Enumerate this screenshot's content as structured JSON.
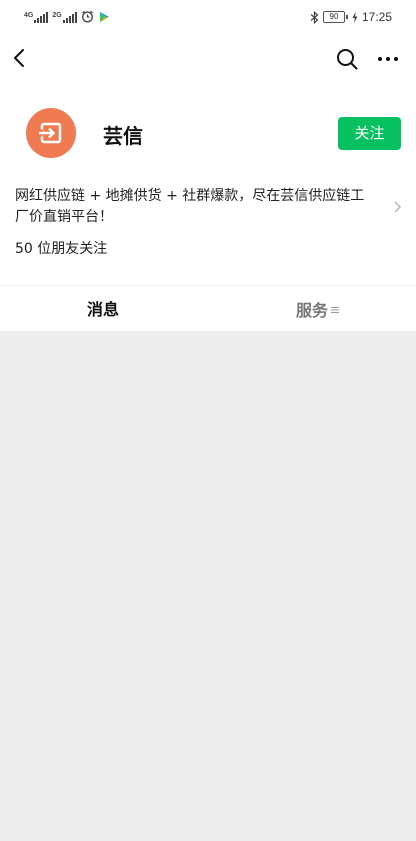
{
  "status_bar": {
    "net1": "4G",
    "net2": "2G",
    "battery": "90",
    "time": "17:25"
  },
  "account": {
    "name": "芸信",
    "follow_label": "关注",
    "avatar_color": "#f07b52",
    "description": "网红供应链 + 地摊供货 + 社群爆款，尽在芸信供应链工厂价直销平台！",
    "followers_text": "50 位朋友关注"
  },
  "tabs": {
    "messages": "消息",
    "services": "服务"
  },
  "icons": {
    "back": "back-arrow-icon",
    "search": "search-icon",
    "more": "more-icon",
    "avatar": "login-arrow-icon",
    "chevron": "chevron-right-icon",
    "menu": "menu-icon"
  },
  "colors": {
    "accent_green": "#07c160",
    "content_bg": "#ededed"
  }
}
